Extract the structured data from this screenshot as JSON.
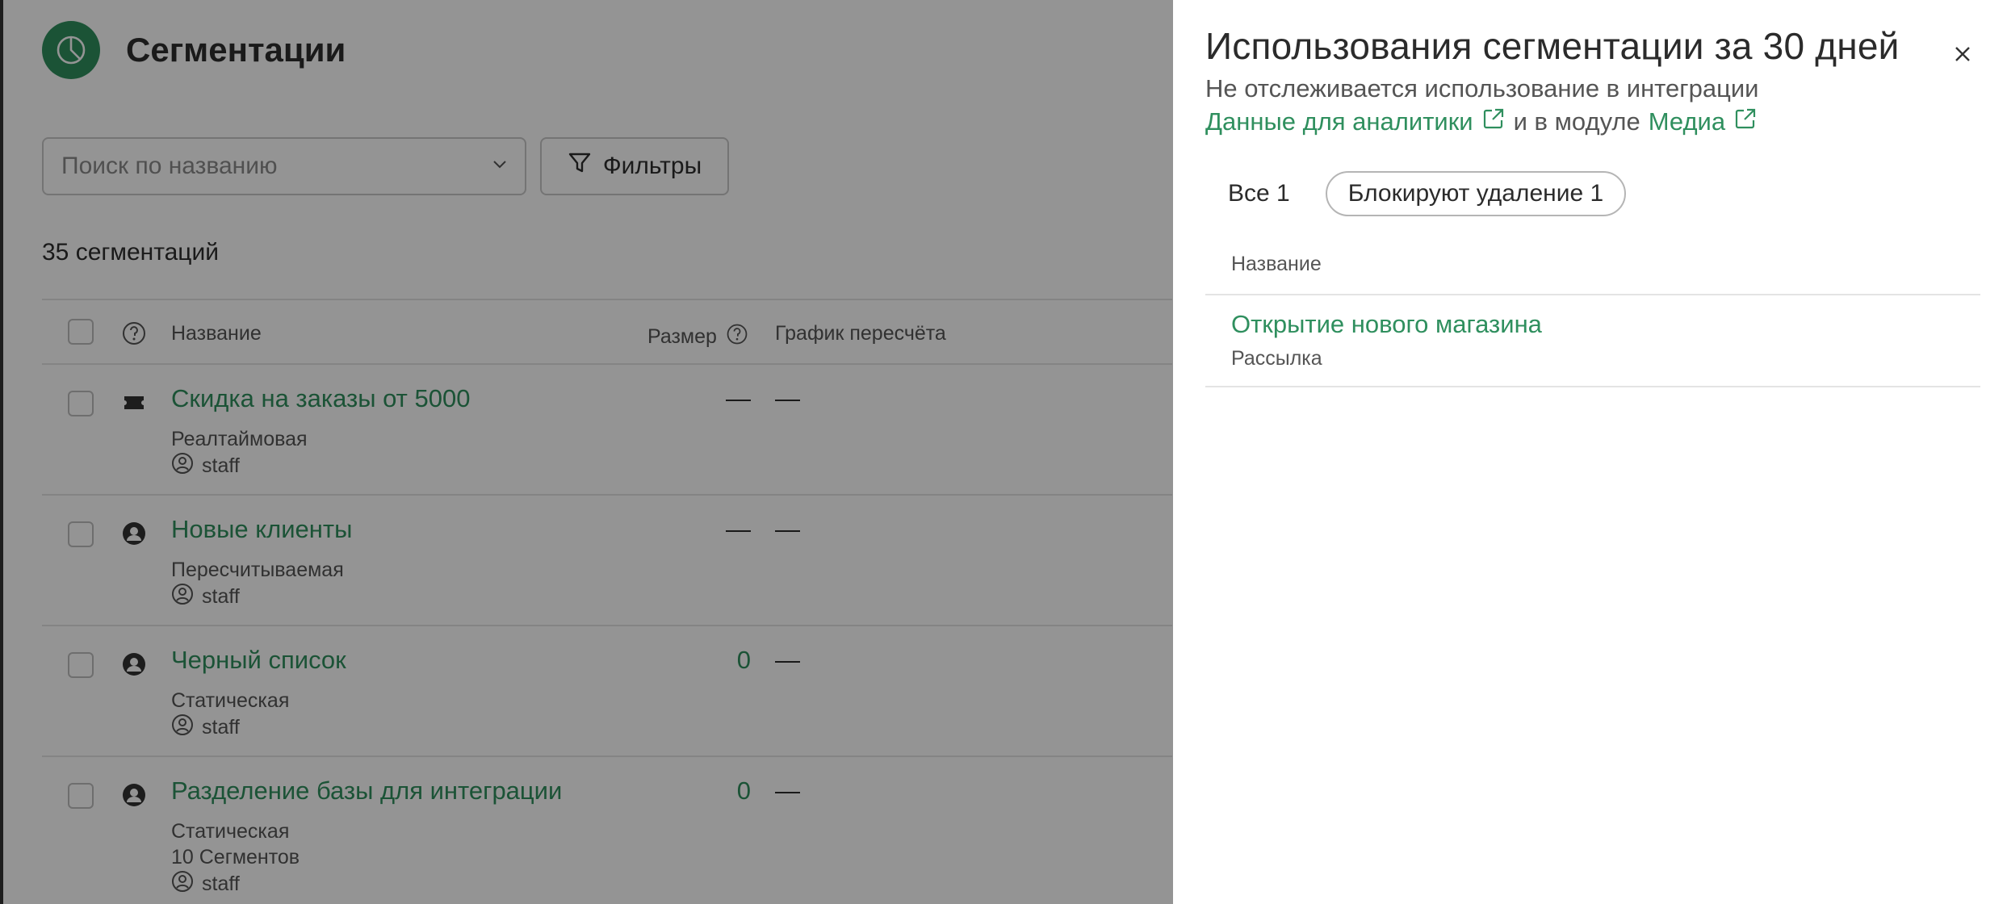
{
  "header": {
    "title": "Сегментации"
  },
  "search": {
    "placeholder": "Поиск по названию"
  },
  "toolbar": {
    "filters_label": "Фильтры"
  },
  "count_label": "35 сегментаций",
  "table": {
    "columns": {
      "name": "Название",
      "size": "Размер",
      "schedule": "График пересчёта"
    },
    "rows": [
      {
        "name": "Скидка на заказы от 5000",
        "kind": "Реалтаймовая",
        "extra": "",
        "author": "staff",
        "size": "—",
        "schedule": "—",
        "icon": "ticket-icon"
      },
      {
        "name": "Новые клиенты",
        "kind": "Пересчитываемая",
        "extra": "",
        "author": "staff",
        "size": "—",
        "schedule": "—",
        "icon": "person-icon"
      },
      {
        "name": "Черный список",
        "kind": "Статическая",
        "extra": "",
        "author": "staff",
        "size": "0",
        "schedule": "—",
        "icon": "person-icon"
      },
      {
        "name": "Разделение базы для интеграции",
        "kind": "Статическая",
        "extra": "10 Сегментов",
        "author": "staff",
        "size": "0",
        "schedule": "—",
        "icon": "person-icon"
      }
    ]
  },
  "panel": {
    "title": "Использования сегментации за 30 дней",
    "note": "Не отслеживается использование в интеграции",
    "link1": "Данные для аналитики",
    "connector": "и в модуле",
    "link2": "Медиа",
    "tabs": [
      {
        "label": "Все 1",
        "active": false
      },
      {
        "label": "Блокируют удаление 1",
        "active": true
      }
    ],
    "table_header": "Название",
    "rows": [
      {
        "name": "Открытие нового магазина",
        "type": "Рассылка"
      }
    ]
  },
  "colors": {
    "accent": "#2f8f5e",
    "overlay": "rgba(0,0,0,0.42)"
  }
}
